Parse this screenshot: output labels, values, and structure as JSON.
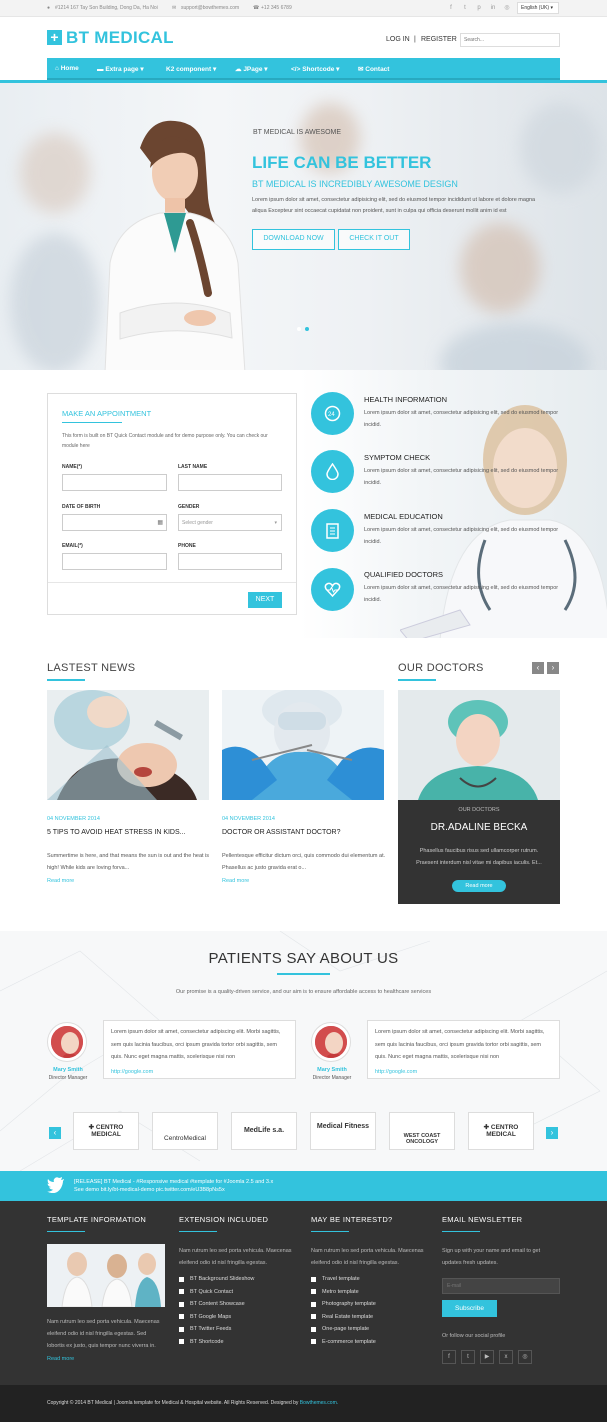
{
  "topbar": {
    "address": "#1214 167 Tay Son Building, Dong Da, Ha Noi",
    "email": "support@bowthemes.com",
    "phone": "+12 345 6789",
    "social_icons": [
      "facebook-icon",
      "twitter-icon",
      "pinterest-icon",
      "linkedin-icon",
      "dribbble-icon"
    ],
    "language": "English (UK)"
  },
  "header": {
    "logo_text": "BT MEDICAL",
    "logo_icon": "+",
    "login": "LOG IN",
    "separator": "|",
    "register": "REGISTER",
    "search_placeholder": "Search..."
  },
  "nav": {
    "items": [
      {
        "label": "Home",
        "icon": "home-icon"
      },
      {
        "label": "Extra page ▾",
        "icon": "folder-icon"
      },
      {
        "label": "K2 component ▾",
        "icon": ""
      },
      {
        "label": "JPage ▾",
        "icon": "cloud-icon"
      },
      {
        "label": "Shortcode ▾",
        "icon": "code-icon"
      },
      {
        "label": "Contact",
        "icon": "envelope-icon"
      }
    ]
  },
  "hero": {
    "kicker": "BT MEDICAL IS AWESOME",
    "title": "LIFE CAN BE BETTER",
    "subtitle": "BT MEDICAL IS INCREDIBLY AWESOME DESIGN",
    "text": "Lorem ipsum dolor sit amet, consectetur adipisicing elit, sed do eiusmod tempor incididunt ut labore et dolore magna aliqua Excepteur sint occaecat cupidatat non proident, sunt in culpa qui officia deserunt mollit anim id est",
    "btn_download": "DOWNLOAD NOW",
    "btn_check": "CHECK IT OUT",
    "slide_count": 2,
    "active_slide": 2
  },
  "appointment": {
    "title": "MAKE AN APPOINTMENT",
    "intro": "This form is built on BT Quick Contact module and for demo purpose only. You can check our module here",
    "name_label": "NAME(*)",
    "last_name_label": "LAST NAME",
    "dob_label": "DATE OF BIRTH",
    "gender_label": "GENDER",
    "gender_placeholder": "Select gender",
    "email_label": "EMAIL(*)",
    "phone_label": "PHONE",
    "next": "NEXT"
  },
  "services": [
    {
      "title": "HEALTH INFORMATION",
      "icon": "24h-icon",
      "text": "Lorem ipsum dolor sit amet, consectetur adipisicing elit, sed do eiusmod tempor incidid."
    },
    {
      "title": "SYMPTOM CHECK",
      "icon": "drop-icon",
      "text": "Lorem ipsum dolor sit amet, consectetur adipisicing elit, sed do eiusmod tempor incidid."
    },
    {
      "title": "MEDICAL EDUCATION",
      "icon": "clipboard-icon",
      "text": "Lorem ipsum dolor sit amet, consectetur adipisicing elit, sed do eiusmod tempor incidid."
    },
    {
      "title": "QUALIFIED DOCTORS",
      "icon": "heart-pulse-icon",
      "text": "Lorem ipsum dolor sit amet, consectetur adipisicing elit, sed do eiusmod tempor incidid."
    }
  ],
  "news": {
    "title": "LASTEST NEWS",
    "items": [
      {
        "date": "04 NOVEMBER 2014",
        "title": "5 TIPS TO AVOID HEAT STRESS IN KIDS...",
        "text": "Summertime is here, and that means the sun is out and the heat is high! While kids are loving forva...",
        "more": "Read more"
      },
      {
        "date": "04 NOVEMBER 2014",
        "title": "DOCTOR OR ASSISTANT DOCTOR?",
        "text": "Pellentesque efficitur dictum orci, quis commodo dui elementum at. Phasellus ac justo gravida erat o...",
        "more": "Read more"
      }
    ]
  },
  "doctors": {
    "title": "OUR DOCTORS",
    "prev": "‹",
    "next": "›",
    "card_kicker": "OUR DOCTORS",
    "name": "DR.ADALINE BECKA",
    "text": "Phasellus faucibus risus sed ullamcorper rutrum. Praesent interdum nisl vitae mi dapibus iaculis. Et...",
    "more": "Read more"
  },
  "patients": {
    "title": "PATIENTS SAY ABOUT US",
    "subtitle": "Our promise is a quality-driven service, and our aim is to ensure affordable access to healthcare services",
    "testimonials": [
      {
        "name": "Mary Smith",
        "role": "Director Manager",
        "text": "Lorem ipsum dolor sit amet, consectetur adipiscing elit. Morbi sagittis, sem quis lacinia faucibus, orci ipsum gravida tortor orbi sagittis, sem quis. Nunc eget magna mattis, scelerisque nisi non",
        "link": "http://google.com"
      },
      {
        "name": "Mary Smith",
        "role": "Director Manager",
        "text": "Lorem ipsum dolor sit amet, consectetur adipiscing elit. Morbi sagittis, sem quis lacinia faucibus, orci ipsum gravida tortor orbi sagittis, sem quis. Nunc eget magna mattis, scelerisque nisi non",
        "link": "http://google.com"
      }
    ],
    "partners": [
      "CENTRO MEDICAL",
      "CentroMedical",
      "MedLife s.a.",
      "Medical Fitness",
      "WEST COAST ONCOLOGY",
      "CENTRO MEDICAL"
    ],
    "prev": "‹",
    "next": "›"
  },
  "twitter": {
    "line1": "[RELEASE] BT Medical - #Responsive medical #template for #Joomla 2.5 and 3.x",
    "line2": "See demo bit.ly/bt-medical-demo pic.twitter.com/eU3B8pNs5x"
  },
  "footer": {
    "col1_title": "TEMPLATE INFORMATION",
    "col1_text": "Nam rutrum leo sed porta vehicula. Maecenas eleifend odio id nisl fringilla egestas. Sed lobortis ex justo, quis tempor nunc viverra in.",
    "col1_more": "Read more",
    "col2_title": "EXTENSION INCLUDED",
    "col2_text": "Nam rutrum leo sed porta vehicula. Maecenas eleifend odio id nisl fringilla egestas.",
    "col2_items": [
      "BT Background Slideshow",
      "BT Quick Contact",
      "BT Content Showcase",
      "BT Google Maps",
      "BT Twitter Feeds",
      "BT Shortcode"
    ],
    "col3_title": "MAY BE INTERESTD?",
    "col3_text": "Nam rutrum leo sed porta vehicula. Maecenas eleifend odio id nisl fringilla egestas.",
    "col3_items": [
      "Travel template",
      "Metro template",
      "Photography template",
      "Real Estate template",
      "One-page template",
      "E-commerce template"
    ],
    "col4_title": "EMAIL NEWSLETTER",
    "col4_text": "Sign up with your name and email to get updates fresh updates.",
    "email_placeholder": "E-mail",
    "subscribe": "Subscribe",
    "follow": "Or follow our social profile",
    "social_icons": [
      "facebook-icon",
      "twitter-icon",
      "youtube-icon",
      "xing-icon",
      "dribbble-icon"
    ],
    "copyright": "Copyright © 2014 BT Medical | Joomla template for Medical & Hospital website. All Rights Reserved. Designed by ",
    "copyright_link": "Bowthemes.com."
  },
  "colors": {
    "accent": "#33c3dd",
    "dark": "#333333"
  }
}
